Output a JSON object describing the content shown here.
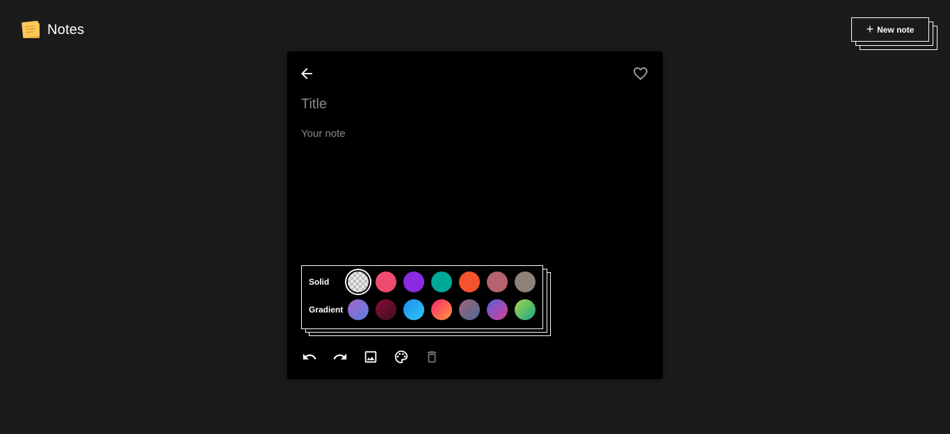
{
  "app": {
    "title": "Notes",
    "logo_icon": "sticky-note-icon"
  },
  "header": {
    "new_note_label": "New note",
    "new_note_icon": "plus-icon"
  },
  "editor": {
    "back_icon": "arrow-left-icon",
    "favorite_icon": "heart-outline-icon",
    "title_value": "",
    "title_placeholder": "Title",
    "note_value": "",
    "note_placeholder": "Your note"
  },
  "palette": {
    "solid_label": "Solid",
    "gradient_label": "Gradient",
    "solid": [
      {
        "name": "transparent",
        "color": "transparent",
        "selected": true
      },
      {
        "name": "pink",
        "color": "#ef4b6f"
      },
      {
        "name": "purple",
        "color": "#8a2be2"
      },
      {
        "name": "teal",
        "color": "#00a896"
      },
      {
        "name": "orange",
        "color": "#f5532d"
      },
      {
        "name": "rose",
        "color": "#b5636f"
      },
      {
        "name": "taupe",
        "color": "#8c8279"
      }
    ],
    "gradient": [
      {
        "name": "violet-blue",
        "from": "#a166c7",
        "to": "#5d7fe0"
      },
      {
        "name": "maroon",
        "from": "#8b0a3a",
        "to": "#3d0f1f"
      },
      {
        "name": "sky",
        "from": "#1e8ff2",
        "to": "#2fc6f0"
      },
      {
        "name": "sunset",
        "from": "#f7246f",
        "to": "#ff9a3c"
      },
      {
        "name": "dusk",
        "from": "#a2627a",
        "to": "#4a6b92"
      },
      {
        "name": "indigo-pink",
        "from": "#5a5ee0",
        "to": "#d63f8e"
      },
      {
        "name": "lime-green",
        "from": "#a8d54a",
        "to": "#17a788"
      }
    ]
  },
  "toolbar": {
    "undo_icon": "undo-icon",
    "redo_icon": "redo-icon",
    "image_icon": "image-icon",
    "palette_icon": "palette-icon",
    "delete_icon": "trash-icon"
  }
}
